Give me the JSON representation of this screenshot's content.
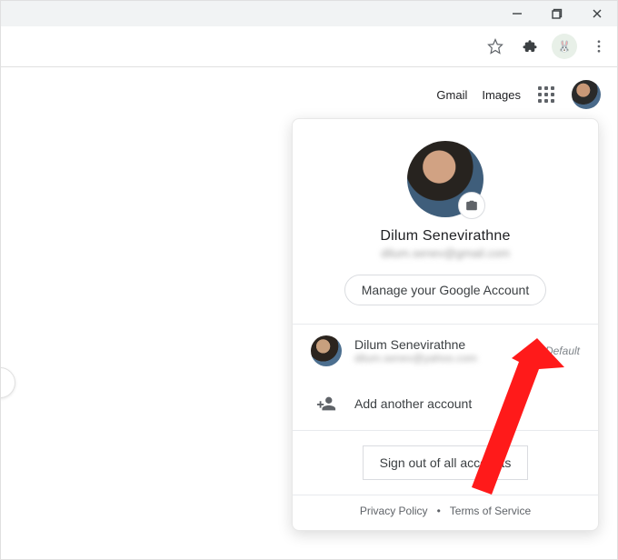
{
  "nav": {
    "gmail": "Gmail",
    "images": "Images"
  },
  "user": {
    "name": "Dilum Senevirathne",
    "email": "dilum.senev@gmail.com"
  },
  "buttons": {
    "manage": "Manage your Google Account",
    "add_account": "Add another account",
    "signout": "Sign out of all accounts"
  },
  "accounts": [
    {
      "name": "Dilum Senevirathne",
      "email": "dilum.senev@yahoo.com",
      "badge": "Default"
    }
  ],
  "footer": {
    "privacy": "Privacy Policy",
    "terms": "Terms of Service"
  }
}
